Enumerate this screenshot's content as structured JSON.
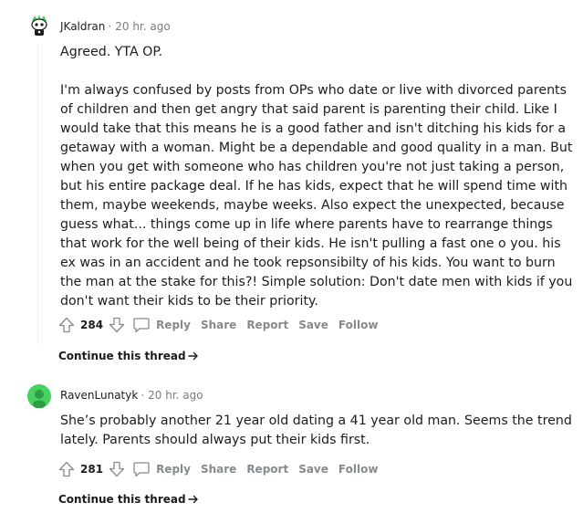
{
  "comments": [
    {
      "author": "JKaldran",
      "time": "20 hr. ago",
      "paragraphs": [
        "Agreed. YTA OP.",
        "I'm always confused by posts from OPs who date or live with divorced parents of children and then get angry that said parent is parenting their child. Like I would take that this means he is a good father and isn't ditching his kids for a getaway with a woman. Might be a dependable and good quality in a man. But when you get with someone who has children you're not just taking a person, but his entire package deal. If he has kids, expect that he will spend time with them, maybe weekends, maybe weeks. Also expect the unexpected, because guess what... things come up in life where parents have to rearrange things that work for the well being of their kids. He isn't pulling a fast one o you. his ex was in an accident and he took repsonsibilty of his kids. You want to burn the man at the stake for this?! Simple solution: Don't date men with kids if you don't want their kids to be their priority."
      ],
      "score": "284",
      "actions": {
        "reply": "Reply",
        "share": "Share",
        "report": "Report",
        "save": "Save",
        "follow": "Follow"
      },
      "continue_label": "Continue this thread"
    },
    {
      "author": "RavenLunatyk",
      "time": "20 hr. ago",
      "paragraphs": [
        "She’s probably another 21 year old dating a 41 year old man. Seems the trend lately. Parents should always put their kids first."
      ],
      "score": "281",
      "actions": {
        "reply": "Reply",
        "share": "Share",
        "report": "Report",
        "save": "Save",
        "follow": "Follow"
      },
      "continue_label": "Continue this thread"
    }
  ],
  "colors": {
    "meta_gray": "#7c7c7c",
    "action_gray": "#878a8c",
    "avatar1_accent": "#46d160",
    "avatar2_bg": "#46d160"
  },
  "icons": [
    "upvote-icon",
    "downvote-icon",
    "comment-bubble-icon",
    "arrow-right-icon",
    "avatar-snoo-icon"
  ]
}
